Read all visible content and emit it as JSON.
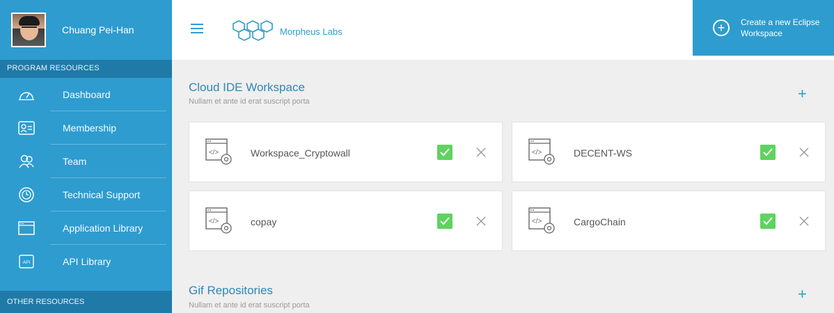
{
  "profile": {
    "name": "Chuang Pei-Han"
  },
  "sidebar": {
    "program_header": "PROGRAM RESOURCES",
    "items": [
      {
        "label": "Dashboard",
        "icon": "speedometer-icon"
      },
      {
        "label": "Membership",
        "icon": "id-card-icon"
      },
      {
        "label": "Team",
        "icon": "team-icon"
      },
      {
        "label": "Technical Support",
        "icon": "support-clock-icon"
      },
      {
        "label": "Application Library",
        "icon": "browser-window-icon"
      },
      {
        "label": "API Library",
        "icon": "api-icon"
      }
    ],
    "other_header": "OTHER RESOURCES"
  },
  "topbar": {
    "brand": "Morpheus Labs",
    "create_label": "Create a new Eclipse Workspace"
  },
  "ide_section": {
    "title": "Cloud IDE Workspace",
    "subtitle": "Nullam et ante id erat suscript porta"
  },
  "workspaces": [
    {
      "name": "Workspace_Cryptowall"
    },
    {
      "name": "DECENT-WS"
    },
    {
      "name": "copay"
    },
    {
      "name": "CargoChain"
    }
  ],
  "git_section": {
    "title": "Gif Repositories",
    "subtitle": "Nullam et ante id erat suscript porta"
  },
  "colors": {
    "accent": "#2e9ccf",
    "dark_accent": "#1f7aa8",
    "check": "#5fd35f"
  }
}
